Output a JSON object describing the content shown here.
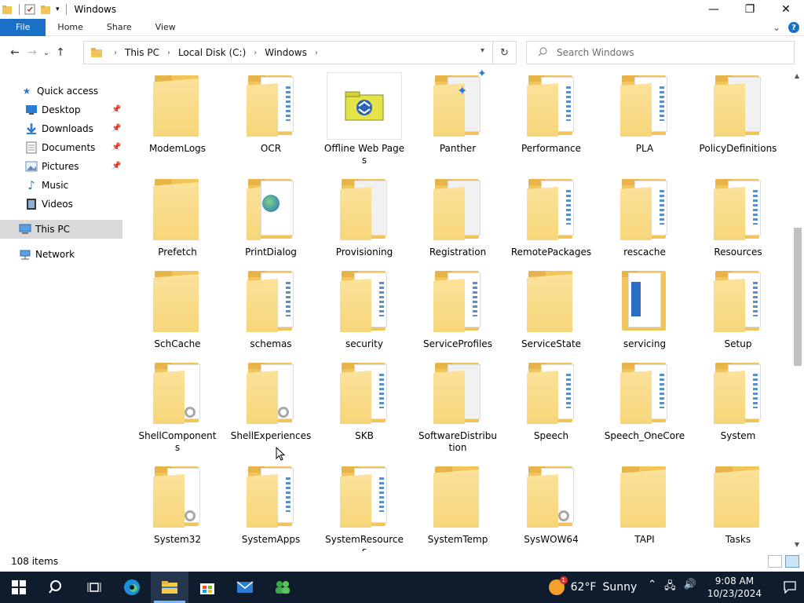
{
  "window": {
    "title": "Windows",
    "minimize": "—",
    "maximize": "❐",
    "close": "✕"
  },
  "ribbon": {
    "tabs": [
      "File",
      "Home",
      "Share",
      "View"
    ],
    "collapse_glyph": "⌄",
    "help": "?"
  },
  "nav": {
    "back": "←",
    "forward": "→",
    "recent": "⌄",
    "up": "↑",
    "breadcrumbs": [
      "This PC",
      "Local Disk (C:)",
      "Windows"
    ],
    "search_placeholder": "Search Windows"
  },
  "sidebar": {
    "quick_access": "Quick access",
    "items": [
      {
        "label": "Desktop",
        "icon": "desktop-icon",
        "pinned": true
      },
      {
        "label": "Downloads",
        "icon": "download-icon",
        "pinned": true
      },
      {
        "label": "Documents",
        "icon": "documents-icon",
        "pinned": true
      },
      {
        "label": "Pictures",
        "icon": "pictures-icon",
        "pinned": true
      },
      {
        "label": "Music",
        "icon": "music-icon",
        "pinned": false
      },
      {
        "label": "Videos",
        "icon": "videos-icon",
        "pinned": false
      }
    ],
    "this_pc": "This PC",
    "network": "Network"
  },
  "folders": [
    {
      "name": "ModemLogs",
      "style": "plain"
    },
    {
      "name": "OCR",
      "style": "docs"
    },
    {
      "name": "Offline Web Pages",
      "style": "offline"
    },
    {
      "name": "Panther",
      "style": "panther"
    },
    {
      "name": "Performance",
      "style": "docs"
    },
    {
      "name": "PLA",
      "style": "docs"
    },
    {
      "name": "PolicyDefinitions",
      "style": "white"
    },
    {
      "name": "Prefetch",
      "style": "plain"
    },
    {
      "name": "PrintDialog",
      "style": "print"
    },
    {
      "name": "Provisioning",
      "style": "white"
    },
    {
      "name": "Registration",
      "style": "white"
    },
    {
      "name": "RemotePackages",
      "style": "docs"
    },
    {
      "name": "rescache",
      "style": "docs"
    },
    {
      "name": "Resources",
      "style": "docs"
    },
    {
      "name": "SchCache",
      "style": "plain"
    },
    {
      "name": "schemas",
      "style": "docs"
    },
    {
      "name": "security",
      "style": "docs"
    },
    {
      "name": "ServiceProfiles",
      "style": "docs"
    },
    {
      "name": "ServiceState",
      "style": "plain"
    },
    {
      "name": "servicing",
      "style": "servicing"
    },
    {
      "name": "Setup",
      "style": "docs"
    },
    {
      "name": "ShellComponents",
      "style": "gear"
    },
    {
      "name": "ShellExperiences",
      "style": "gear"
    },
    {
      "name": "SKB",
      "style": "docs"
    },
    {
      "name": "SoftwareDistribution",
      "style": "white"
    },
    {
      "name": "Speech",
      "style": "docs"
    },
    {
      "name": "Speech_OneCore",
      "style": "docs"
    },
    {
      "name": "System",
      "style": "docs"
    },
    {
      "name": "System32",
      "style": "gear"
    },
    {
      "name": "SystemApps",
      "style": "docs"
    },
    {
      "name": "SystemResources",
      "style": "docs"
    },
    {
      "name": "SystemTemp",
      "style": "plain"
    },
    {
      "name": "SysWOW64",
      "style": "gear"
    },
    {
      "name": "TAPI",
      "style": "plain"
    },
    {
      "name": "Tasks",
      "style": "plain"
    }
  ],
  "status": {
    "item_count": "108 items"
  },
  "taskbar": {
    "weather_temp": "62°F",
    "weather_text": "Sunny",
    "weather_badge": "1",
    "time": "9:08 AM",
    "date": "10/23/2024"
  },
  "colors": {
    "accent": "#1a6fc6",
    "folder": "#f7d67a",
    "taskbar": "#0f1c2e"
  }
}
